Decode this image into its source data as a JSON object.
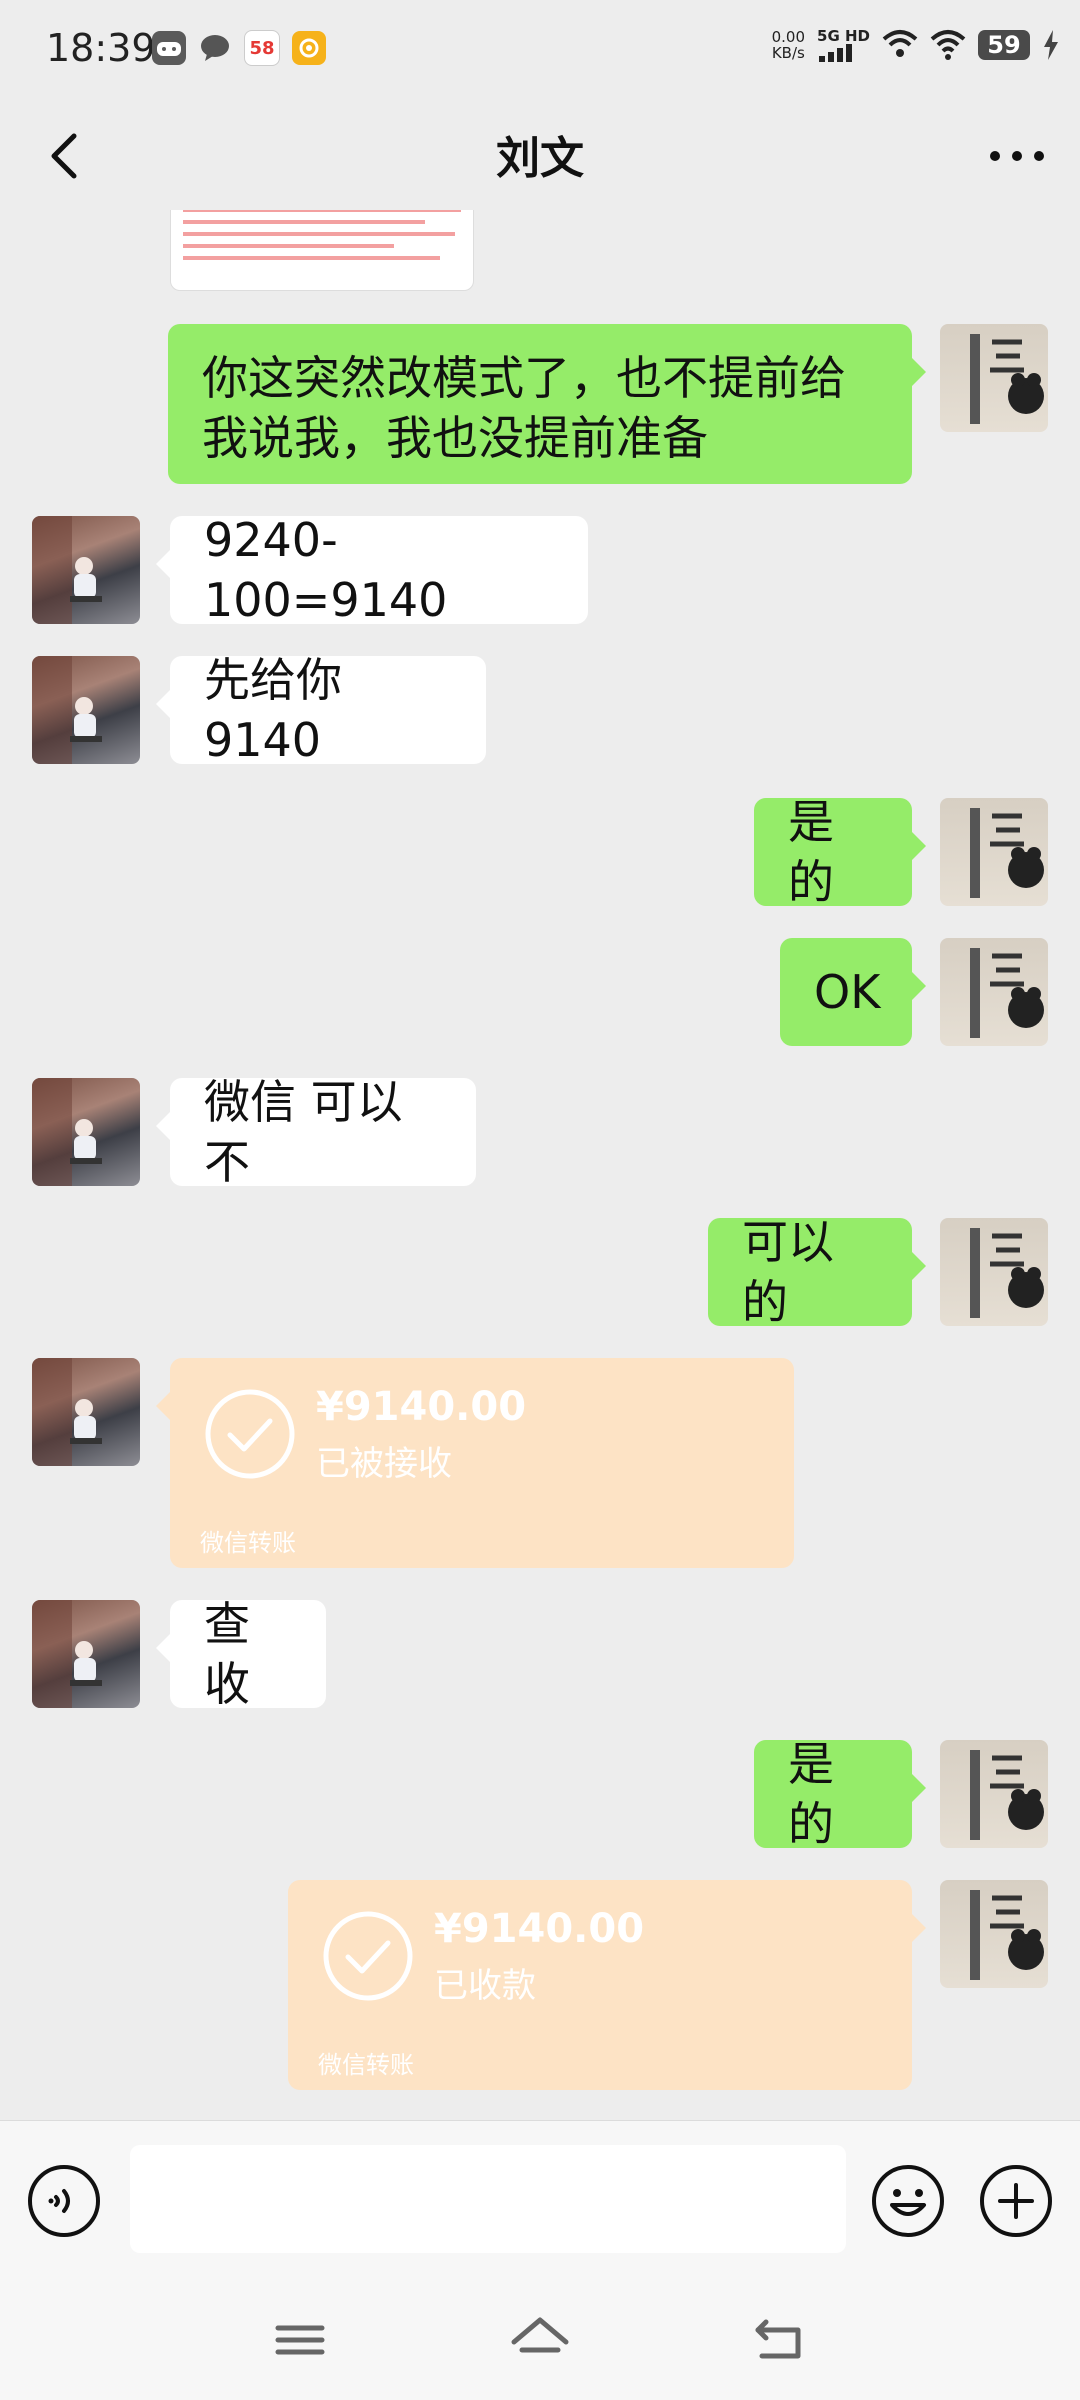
{
  "status_bar": {
    "time": "18:39",
    "app_58": "58",
    "net_speed_value": "0.00",
    "net_speed_unit": "KB/s",
    "network": "5G HD",
    "battery": "59"
  },
  "header": {
    "title": "刘文"
  },
  "messages": [
    {
      "side": "right",
      "type": "text",
      "text": "你这突然改模式了，也不提前给我说我，我也没提前准备"
    },
    {
      "side": "left",
      "type": "text",
      "text": "9240-100=9140"
    },
    {
      "side": "left",
      "type": "text",
      "text": "先给你 9140"
    },
    {
      "side": "right",
      "type": "text",
      "text": "是的"
    },
    {
      "side": "right",
      "type": "text",
      "text": "OK"
    },
    {
      "side": "left",
      "type": "text",
      "text": "微信 可以不"
    },
    {
      "side": "right",
      "type": "text",
      "text": "可以的"
    },
    {
      "side": "left",
      "type": "transfer",
      "amount": "¥9140.00",
      "status": "已被接收",
      "footer": "微信转账"
    },
    {
      "side": "left",
      "type": "text",
      "text": "查收"
    },
    {
      "side": "right",
      "type": "text",
      "text": "是的"
    },
    {
      "side": "right",
      "type": "transfer",
      "amount": "¥9140.00",
      "status": "已收款",
      "footer": "微信转账"
    }
  ],
  "colors": {
    "background": "#ededed",
    "sent_bubble": "#95ec69",
    "received_bubble": "#ffffff",
    "transfer_card": "#fde3c5"
  },
  "icons": {
    "back": "chevron-left-icon",
    "more": "more-dots-icon",
    "voice": "voice-icon",
    "emoji": "emoji-icon",
    "plus": "plus-icon",
    "transfer": "check-circle-icon",
    "nav_menu": "menu-icon",
    "nav_home": "home-icon",
    "nav_back": "back-icon"
  }
}
